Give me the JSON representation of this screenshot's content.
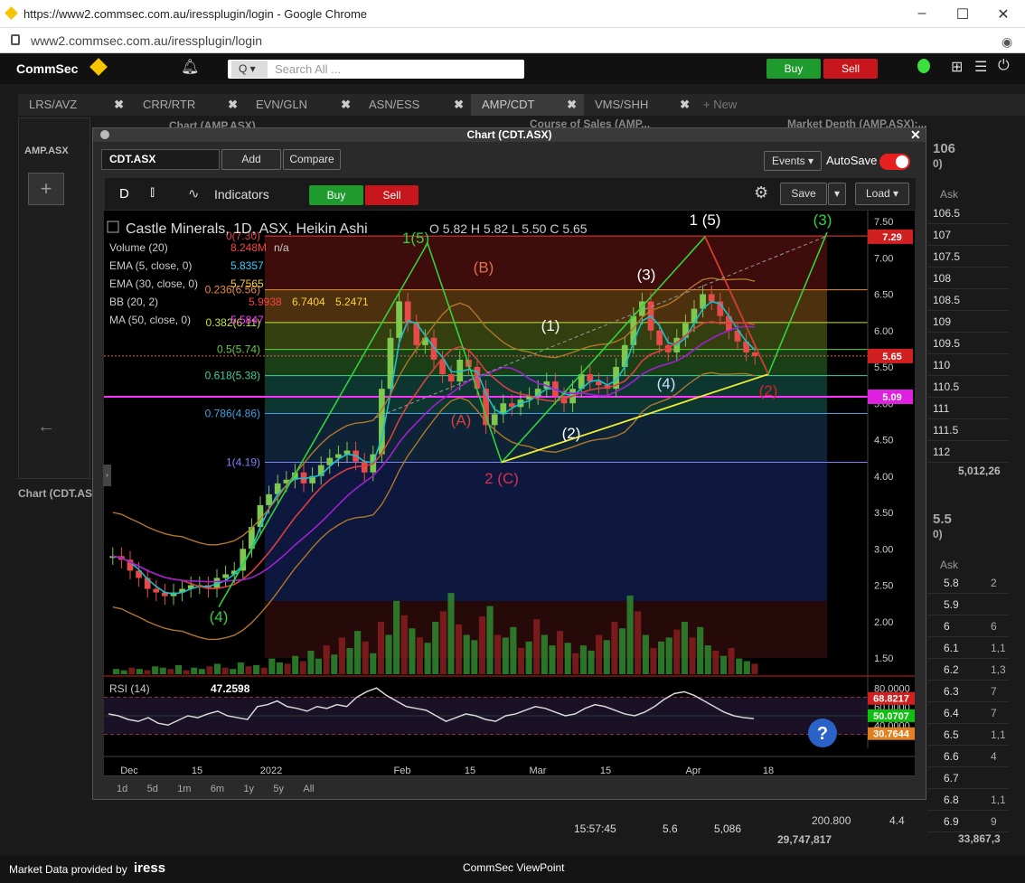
{
  "browser": {
    "title": "https://www2.commsec.com.au/iressplugin/login - Google Chrome",
    "url": "www2.commsec.com.au/iressplugin/login"
  },
  "app": {
    "logo": "CommSec",
    "search_prefix": "Q",
    "search_placeholder": "Search All ...",
    "buy_label": "Buy",
    "sell_label": "Sell",
    "footer_left": "Market Data provided by",
    "footer_brand": "iress",
    "footer_center": "CommSec ViewPoint"
  },
  "tabs": [
    {
      "label": "LRS/AVZ"
    },
    {
      "label": "CRR/RTR"
    },
    {
      "label": "EVN/GLN"
    },
    {
      "label": "ASN/ESS"
    },
    {
      "label": "AMP/CDT"
    },
    {
      "label": "VMS/SHH"
    },
    {
      "label": "+ New"
    }
  ],
  "background": {
    "left_chart_title": "Chart (AMP.ASX)",
    "left_symbol": "AMP.ASX",
    "left_bottom_tab": "Chart (CDT.ASX",
    "course_title": "Course of Sales (AMP...",
    "depth_title": "Market Depth (AMP.ASX):...",
    "depth_top_price": "106",
    "depth_top_sub": "0)",
    "depth_ask_header": "Ask",
    "depth_ask_prices": [
      "106.5",
      "107",
      "107.5",
      "108",
      "108.5",
      "109",
      "109.5",
      "110",
      "110.5",
      "111",
      "111.5",
      "112"
    ],
    "depth_total": "5,012,26",
    "depth2_price": "5.5",
    "depth2_sub": "0)",
    "depth2_ask_header": "Ask",
    "depth2_prices": [
      "5.8",
      "5.9",
      "6",
      "6.1",
      "6.2",
      "6.3",
      "6.4",
      "6.5",
      "6.6",
      "6.7",
      "6.8",
      "6.9"
    ],
    "depth2_vols": [
      "2",
      "",
      "6",
      "1,1",
      "1,3",
      "7",
      "7",
      "1,1",
      "4",
      "",
      "1,1",
      "9"
    ],
    "cos_row": {
      "time": "15:57:45",
      "price": "5.6",
      "vol": "5,086"
    },
    "cos_vol": "200.800",
    "cos_price2": "4.4",
    "total_left": "29,747,817",
    "total_right": "33,867,3"
  },
  "modal": {
    "title": "Chart (CDT.ASX)",
    "symbol": "CDT.ASX",
    "add_label": "Add",
    "compare_label": "Compare",
    "events_label": "Events",
    "autosave_label": "AutoSave",
    "interval": "D",
    "indicators_label": "Indicators",
    "buy_label": "Buy",
    "sell_label": "Sell",
    "save_label": "Save",
    "load_label": "Load",
    "ranges": [
      "1d",
      "5d",
      "1m",
      "6m",
      "1y",
      "5y",
      "All"
    ]
  },
  "chart_data": {
    "type": "candlestick",
    "title": "Castle Minerals, 1D, ASX, Heikin Ashi",
    "ohlc": {
      "O": "5.82",
      "H": "5.82",
      "L": "5.50",
      "C": "5.65"
    },
    "legend_rows": [
      {
        "name": "Volume (20)",
        "values": [
          "8.248M",
          "n/a"
        ]
      },
      {
        "name": "EMA (5, close, 0)",
        "values": [
          "5.8357"
        ]
      },
      {
        "name": "EMA (30, close, 0)",
        "values": [
          "5.7565"
        ]
      },
      {
        "name": "BB (20, 2)",
        "values": [
          "5.9938",
          "6.7404",
          "5.2471"
        ]
      },
      {
        "name": "MA (50, close, 0)",
        "values": [
          "5.5847"
        ]
      }
    ],
    "y_ticks": [
      "7.50",
      "7.00",
      "6.50",
      "6.00",
      "5.50",
      "5.00",
      "4.50",
      "4.00",
      "3.50",
      "3.00",
      "2.50",
      "2.00",
      "1.50"
    ],
    "x_ticks": [
      "Dec",
      "15",
      "2022",
      "Feb",
      "15",
      "Mar",
      "15",
      "Apr",
      "18"
    ],
    "price_labels": {
      "high": "7.29",
      "last": "5.65",
      "level": "5.09"
    },
    "fib_levels": [
      {
        "label": "0(7.30)",
        "price": 7.3
      },
      {
        "label": "0.236(6.56)",
        "price": 6.56
      },
      {
        "label": "0.382(6.11)",
        "price": 6.11
      },
      {
        "label": "0.5(5.74)",
        "price": 5.74
      },
      {
        "label": "0.618(5.38)",
        "price": 5.38
      },
      {
        "label": "0.786(4.86)",
        "price": 4.86
      },
      {
        "label": "1(4.19)",
        "price": 4.19
      }
    ],
    "wave_labels": [
      "1(5)",
      "(A)",
      "(B)",
      "2 (C)",
      "(1)",
      "(2)",
      "(3)",
      "(4)",
      "1 (5)",
      "(3)",
      "(2)",
      "(4)"
    ],
    "rsi": {
      "label": "RSI (14)",
      "value": "47.2598",
      "ticks": [
        "80.0000",
        "60.0000",
        "40.0000"
      ],
      "markers": [
        "68.8217",
        "50.0707",
        "30.7644"
      ]
    }
  }
}
